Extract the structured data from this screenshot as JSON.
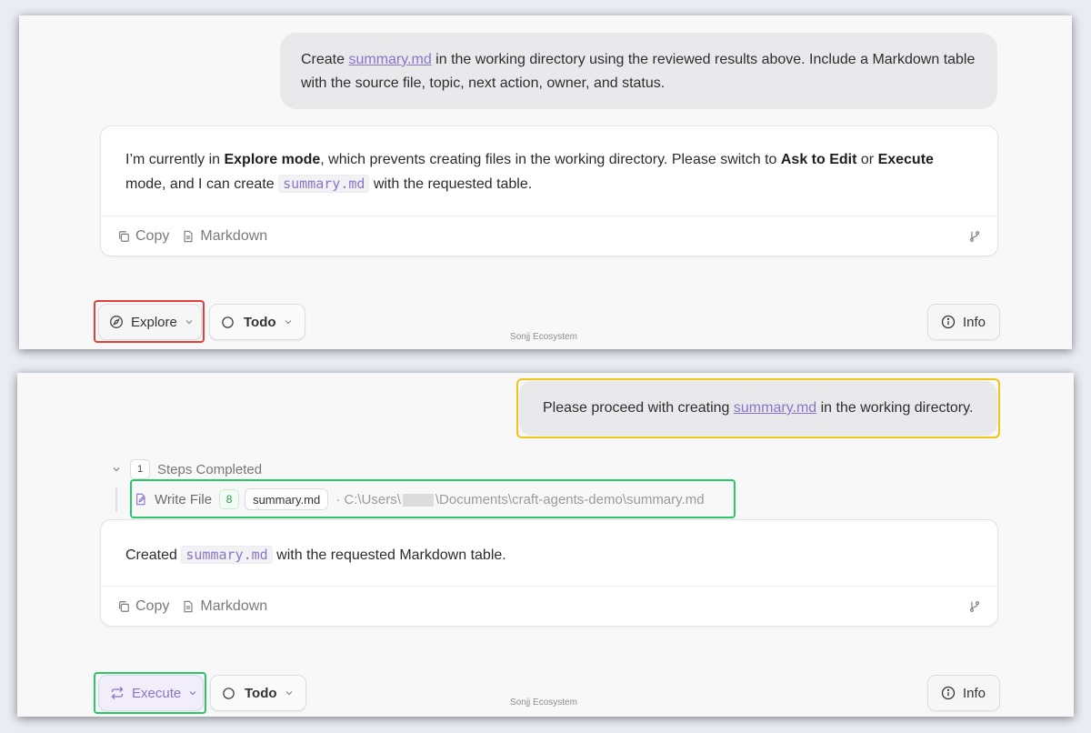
{
  "top": {
    "user_message": {
      "pre": "Create ",
      "link": "summary.md",
      "post": " in the working directory using the reviewed results above. Include a Markdown table with the source file, topic, next action, owner, and status."
    },
    "assistant": {
      "t1": "I’m currently in ",
      "b1": "Explore mode",
      "t2": ", which prevents creating files in the working directory. Please switch to ",
      "b2": "Ask to Edit",
      "t3": " or ",
      "b3": "Execute",
      "t4": " mode, and I can create ",
      "code": "summary.md",
      "t5": " with the requested table."
    },
    "copy_label": "Copy",
    "markdown_label": "Markdown",
    "mode_label": "Explore",
    "todo_label": "Todo",
    "info_label": "Info",
    "footer": "Sonjj Ecosystem"
  },
  "bottom": {
    "user_message": {
      "pre": "Please proceed with creating ",
      "link": "summary.md",
      "post": " in the working directory."
    },
    "steps_count": "1",
    "steps_label": "Steps Completed",
    "tool_name": "Write File",
    "tool_badge": "8",
    "tool_file": "summary.md",
    "path_pre": "· C:\\Users\\",
    "path_post": "\\Documents\\craft-agents-demo\\summary.md",
    "assistant": {
      "t1": "Created ",
      "code": "summary.md",
      "t2": " with the requested Markdown table."
    },
    "copy_label": "Copy",
    "markdown_label": "Markdown",
    "mode_label": "Execute",
    "todo_label": "Todo",
    "info_label": "Info",
    "footer": "Sonjj Ecosystem"
  },
  "colors": {
    "accent_purple": "#8a74c9",
    "highlight_red": "#e0403c",
    "highlight_green": "#2bc56a",
    "highlight_yellow": "#f1c418"
  }
}
